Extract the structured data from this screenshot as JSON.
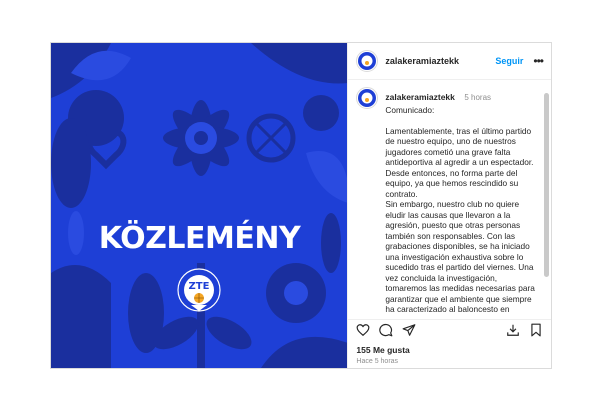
{
  "post": {
    "image": {
      "headline": "KÖZLEMÉNY",
      "logo_text": "ZTE",
      "logo_ring_text": "ZALAEGERSZEGI KOSÁRLABDA CLUB",
      "colors": {
        "background": "#1e3fd6",
        "shapes": "#1a2f9e",
        "headline": "#ffffff",
        "logo_accent": "#f5a623"
      }
    },
    "header": {
      "username": "zalakeramiaztekk",
      "follow_label": "Seguir",
      "more_icon": "ellipsis-icon"
    },
    "caption": {
      "username": "zalakeramiaztekk",
      "time": "5 horas",
      "paragraphs": [
        "Comunicado:",
        "",
        "Lamentablemente, tras el último partido de nuestro equipo, uno de nuestros jugadores cometió una grave falta antideportiva al agredir a un espectador. Desde entonces, no forma parte del equipo, ya que hemos rescindido su contrato.",
        "Sin embargo, nuestro club no quiere eludir las causas que llevaron a la agresión, puesto que otras personas también son responsables. Con las grabaciones disponibles, se ha iniciado una investigación exhaustiva sobre lo sucedido tras el partido del viernes. Una vez concluida la investigación, tomaremos las medidas necesarias para garantizar que el ambiente que siempre ha caracterizado al baloncesto en"
      ]
    },
    "actions": {
      "icons": [
        "heart-icon",
        "comment-icon",
        "share-icon",
        "download-icon",
        "save-icon"
      ]
    },
    "likes": "155 Me gusta",
    "posted_ago": "Hace 5 horas"
  }
}
